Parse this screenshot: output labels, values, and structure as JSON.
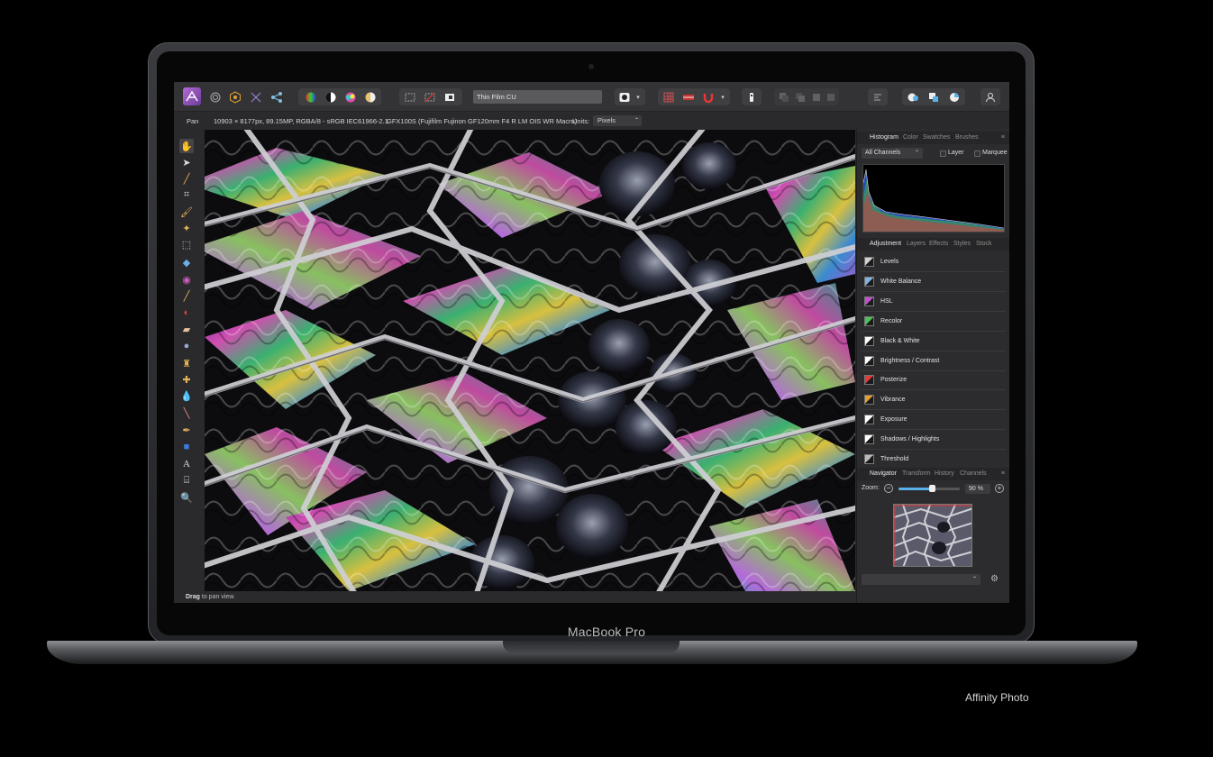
{
  "device": {
    "label": "MacBook Pro"
  },
  "caption": "Affinity Photo",
  "toolbar": {
    "document_name": "Thin Film CU"
  },
  "context_bar": {
    "tool": "Pan",
    "image_info": "10903 × 8177px, 89.15MP, RGBA/8 - sRGB IEC61966-2.1",
    "camera": "GFX100S (Fujifilm Fujinon GF120mm F4 R LM OIS WR Macro)",
    "units_label": "Units:",
    "units_value": "Pixels"
  },
  "status": {
    "bold": "Drag",
    "rest": " to pan view."
  },
  "histogram_panel": {
    "tabs": [
      "Histogram",
      "Color",
      "Swatches",
      "Brushes"
    ],
    "channels": "All Channels",
    "layer_label": "Layer",
    "marquee_label": "Marquee"
  },
  "adjustment_panel": {
    "tabs": [
      "Adjustment",
      "Layers",
      "Effects",
      "Styles",
      "Stock"
    ],
    "items": [
      {
        "label": "Levels",
        "icon": "levels-icon",
        "color": "#d0d0d0"
      },
      {
        "label": "White Balance",
        "icon": "white-balance-icon",
        "color": "#7fb3e0"
      },
      {
        "label": "HSL",
        "icon": "hsl-icon",
        "color": "#c44fd0"
      },
      {
        "label": "Recolor",
        "icon": "recolor-icon",
        "color": "#4cc05a"
      },
      {
        "label": "Black & White",
        "icon": "black-white-icon",
        "color": "#ffffff"
      },
      {
        "label": "Brightness / Contrast",
        "icon": "brightness-contrast-icon",
        "color": "#ffffff"
      },
      {
        "label": "Posterize",
        "icon": "posterize-icon",
        "color": "#e03a3a"
      },
      {
        "label": "Vibrance",
        "icon": "vibrance-icon",
        "color": "#e0a030"
      },
      {
        "label": "Exposure",
        "icon": "exposure-icon",
        "color": "#ffffff"
      },
      {
        "label": "Shadows / Highlights",
        "icon": "shadows-highlights-icon",
        "color": "#ffffff"
      },
      {
        "label": "Threshold",
        "icon": "threshold-icon",
        "color": "#bbbbbb"
      }
    ]
  },
  "navigator_panel": {
    "tabs": [
      "Navigator",
      "Transform",
      "History",
      "Channels"
    ],
    "zoom_label": "Zoom:",
    "zoom_value": "90 %",
    "zoom_fraction": 0.55
  },
  "colors": {
    "accent": "#b56bd6",
    "tool_icon": "#e6b15a"
  }
}
